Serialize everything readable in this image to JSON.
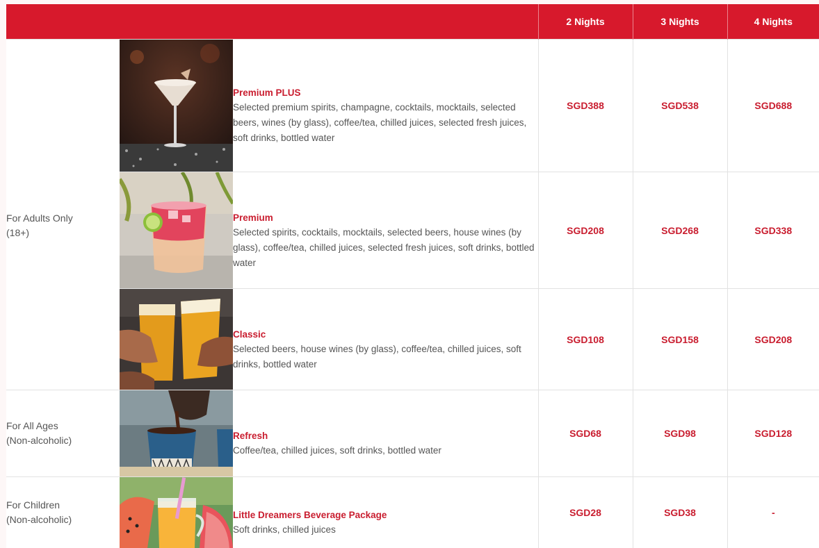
{
  "header": {
    "nights": [
      "2 Nights",
      "3 Nights",
      "4 Nights"
    ]
  },
  "categories": {
    "adults": [
      "For Adults Only",
      "(18+)"
    ],
    "all_ages": [
      "For All Ages",
      "(Non-alcoholic)"
    ],
    "children": [
      "For Children",
      "(Non-alcoholic)"
    ]
  },
  "packages": [
    {
      "name": "Premium PLUS",
      "description": "Selected premium spirits, champagne, cocktails, mocktails, selected beers, wines (by glass), coffee/tea, chilled juices, selected fresh juices, soft drinks, bottled water",
      "image": "cocktail-photo",
      "prices": [
        "SGD388",
        "SGD538",
        "SGD688"
      ]
    },
    {
      "name": "Premium",
      "description": "Selected spirits, cocktails, mocktails, selected beers, house wines (by glass), coffee/tea, chilled juices, selected fresh juices, soft drinks, bottled water",
      "image": "pink-drink-photo",
      "prices": [
        "SGD208",
        "SGD268",
        "SGD338"
      ]
    },
    {
      "name": "Classic",
      "description": "Selected beers, house wines (by glass), coffee/tea, chilled juices, soft drinks, bottled water",
      "image": "beer-toast-photo",
      "prices": [
        "SGD108",
        "SGD158",
        "SGD208"
      ]
    },
    {
      "name": "Refresh",
      "description": "Coffee/tea, chilled juices, soft drinks, bottled water",
      "image": "coffee-pour-photo",
      "prices": [
        "SGD68",
        "SGD98",
        "SGD128"
      ]
    },
    {
      "name": "Little Dreamers Beverage Package",
      "description": "Soft drinks, chilled juices",
      "image": "juice-jar-photo",
      "prices": [
        "SGD28",
        "SGD38",
        "-"
      ]
    }
  ],
  "colors": {
    "accent": "#d7192c",
    "price": "#c91d2f",
    "border": "#e2e2e2"
  }
}
